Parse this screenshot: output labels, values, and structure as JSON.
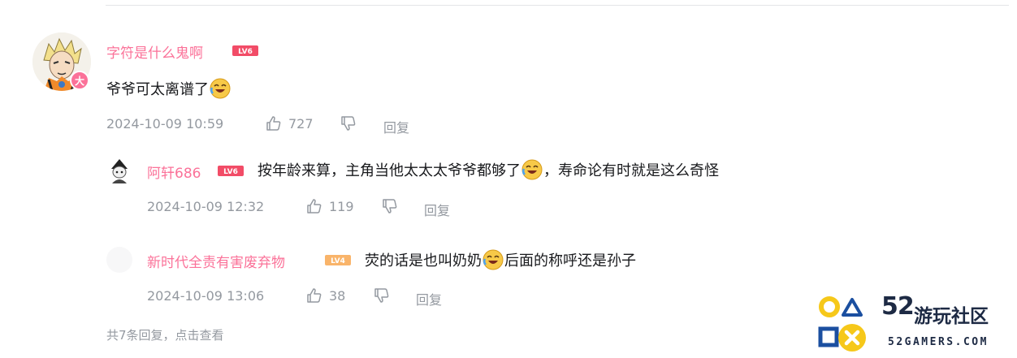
{
  "main_comment": {
    "username": "字符是什么鬼啊",
    "level": "LV6",
    "avatar_badge": "大",
    "text": "爷爷可太离谱了",
    "time": "2024-10-09 10:59",
    "likes": "727",
    "reply_label": "回复"
  },
  "replies": [
    {
      "username": "阿轩686",
      "level": "LV6",
      "text_before": "按年龄来算，主角当他太太太爷爷都够了",
      "text_after": "，寿命论有时就是这么奇怪",
      "time": "2024-10-09 12:32",
      "likes": "119",
      "reply_label": "回复"
    },
    {
      "username": "新时代全责有害废弃物",
      "level": "LV4",
      "text_before": "荧的话是也叫奶奶",
      "text_after": "后面的称呼还是孙子",
      "time": "2024-10-09 13:06",
      "likes": "38",
      "reply_label": "回复"
    }
  ],
  "more_replies": "共7条回复，点击查看",
  "watermark": {
    "brand_number": "52",
    "brand_text": "游玩社区",
    "domain": "52GAMERS.COM"
  },
  "colors": {
    "username_pink": "#fb7299",
    "meta_gray": "#9499a0",
    "lv6_red": "#f24c67",
    "lv4_orange": "#f9b46a",
    "logo_yellow": "#f6c81a",
    "logo_blue": "#1b4fa0"
  },
  "icons": [
    "thumb-up-icon",
    "thumb-down-icon",
    "laughing-crying-emoji-icon"
  ]
}
